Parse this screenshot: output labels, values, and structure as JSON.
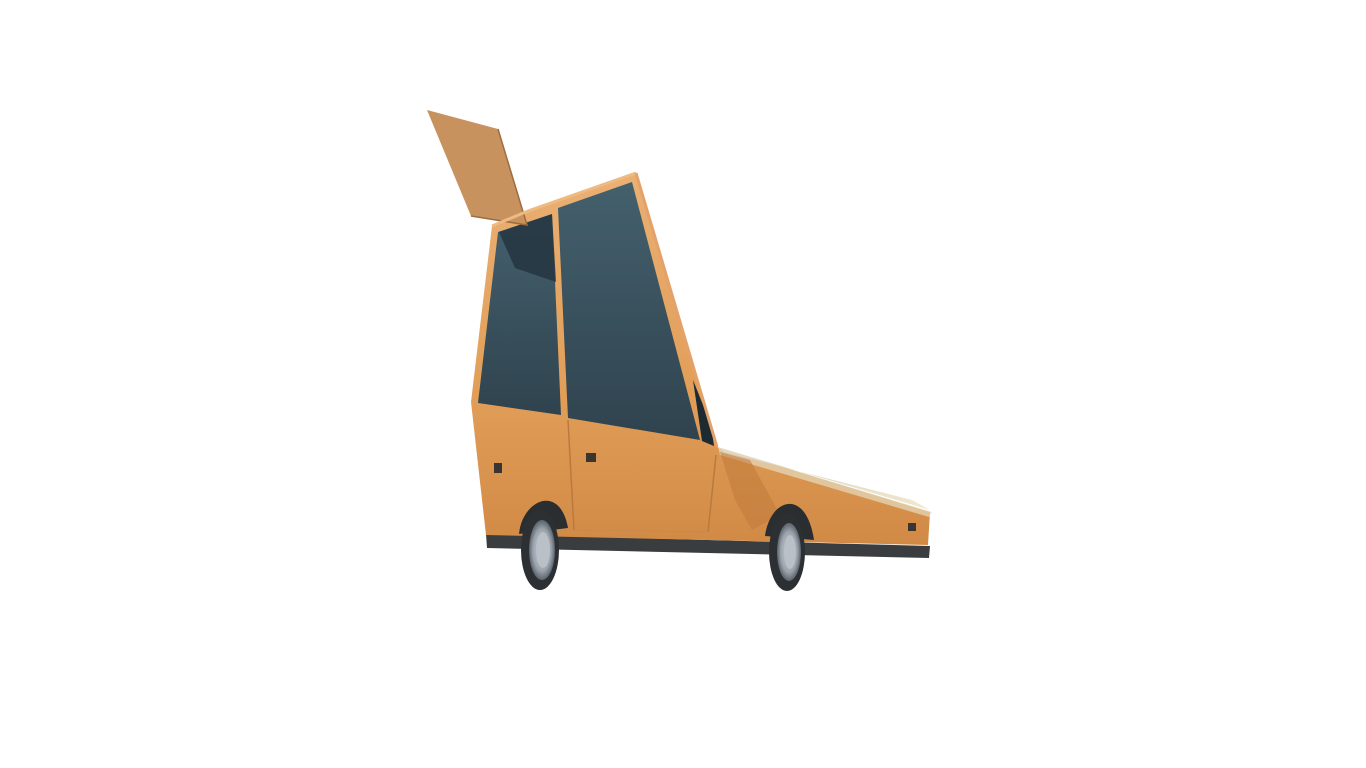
{
  "scene": {
    "background": "#ffffff",
    "object": "car-3d-model",
    "colors": {
      "body": "#e3a35c",
      "body_light": "#efb976",
      "body_dark": "#c9803f",
      "trim": "#d9955a",
      "glass": "#38505c",
      "glass_dark": "#24343d",
      "flap": "#c8925f",
      "flap_edge": "#a87648",
      "bumper": "#3a3d3f",
      "tire": "#2c3033",
      "rim": "#a9b0b8",
      "hood": "#dcdcd8"
    }
  }
}
